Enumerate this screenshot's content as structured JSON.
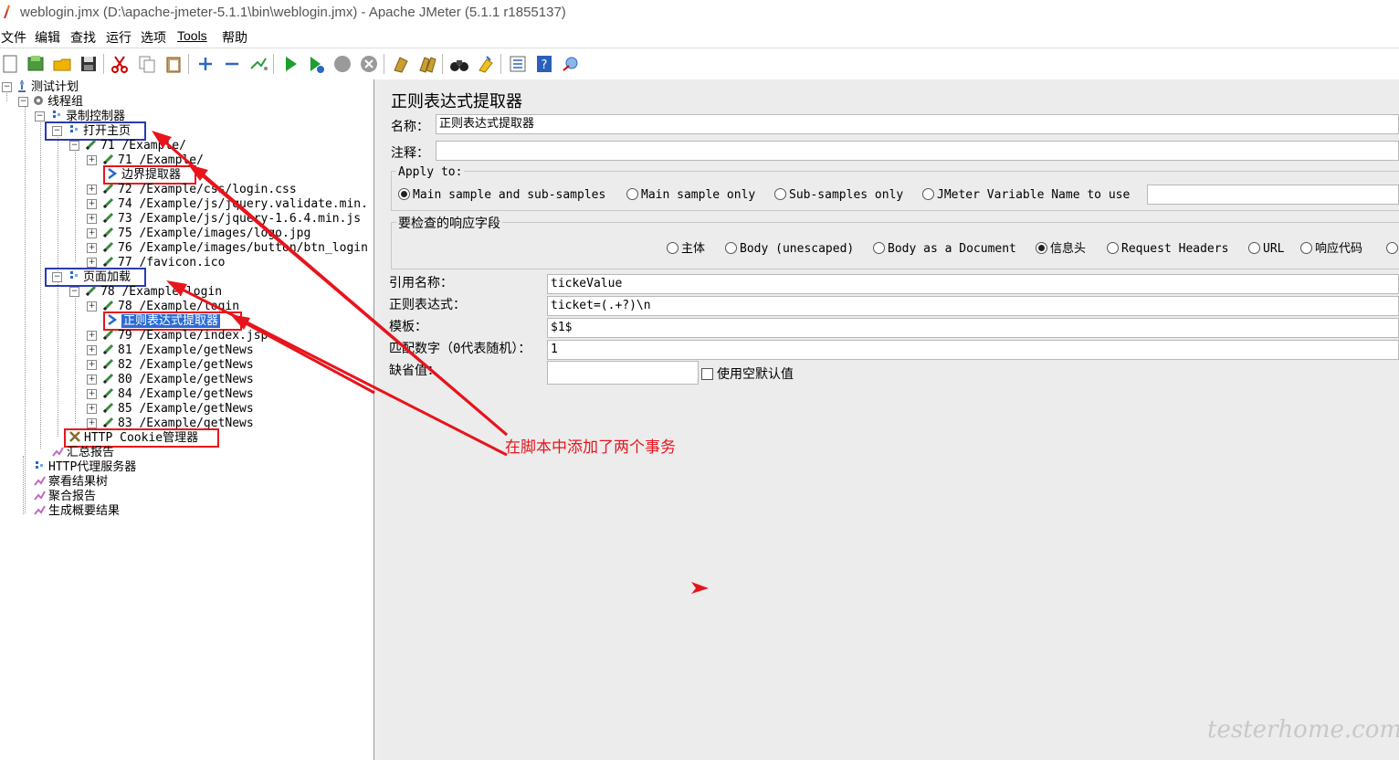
{
  "window": {
    "title": "weblogin.jmx (D:\\apache-jmeter-5.1.1\\bin\\weblogin.jmx) - Apache JMeter (5.1.1 r1855137)"
  },
  "menu": {
    "file": "文件",
    "edit": "编辑",
    "search": "查找",
    "run": "运行",
    "options": "选项",
    "tools": "Tools",
    "help": "帮助"
  },
  "tree": {
    "test_plan": "测试计划",
    "thread_group": "线程组",
    "recording_controller": "录制控制器",
    "transaction_open_home": "打开主页",
    "s71a": "71 /Example/",
    "s71b": "71 /Example/",
    "boundary_extractor": "边界提取器",
    "s72": "72 /Example/css/login.css",
    "s74": "74 /Example/js/jquery.validate.min.",
    "s73": "73 /Example/js/jquery-1.6.4.min.js",
    "s75": "75 /Example/images/logo.jpg",
    "s76": "76 /Example/images/button/btn_login",
    "s77": "77 /favicon.ico",
    "transaction_page_load": "页面加载",
    "s78a": "78 /Example/login",
    "s78b": "78 /Example/login",
    "regex_extractor": "正则表达式提取器",
    "s79": "79 /Example/index.jsp",
    "s81": "81 /Example/getNews",
    "s82": "82 /Example/getNews",
    "s80": "80 /Example/getNews",
    "s84": "84 /Example/getNews",
    "s85": "85 /Example/getNews",
    "s83": "83 /Example/getNews",
    "cookie_manager": "HTTP Cookie管理器",
    "summary_report": "汇总报告",
    "proxy_server": "HTTP代理服务器",
    "view_results_tree": "察看结果树",
    "aggregate_report": "聚合报告",
    "generate_summary": "生成概要结果"
  },
  "panel": {
    "title": "正则表达式提取器",
    "name_label": "名称：",
    "name_value": "正则表达式提取器",
    "comment_label": "注释：",
    "comment_value": "",
    "apply_to": {
      "label": "Apply to:",
      "options": [
        "Main sample and sub-samples",
        "Main sample only",
        "Sub-samples only",
        "JMeter Variable Name to use"
      ],
      "selected": 0,
      "variable_value": ""
    },
    "field_to_check": {
      "label": "要检查的响应字段",
      "options": [
        "主体",
        "Body (unescaped)",
        "Body as a Document",
        "信息头",
        "Request Headers",
        "URL",
        "响应代码"
      ],
      "selected": 3
    },
    "ref_name_label": "引用名称：",
    "ref_name_value": "tickeValue",
    "regex_label": "正则表达式：",
    "regex_value": "ticket=(.+?)\\n",
    "template_label": "模板：",
    "template_value": "$1$",
    "match_no_label": "匹配数字（0代表随机）：",
    "match_no_value": "1",
    "default_label": "缺省值：",
    "default_value": "",
    "use_empty_label": "使用空默认值"
  },
  "annotation": {
    "text": "在脚本中添加了两个事务",
    "color": "#e8141c"
  },
  "watermark": "testerhome.com"
}
